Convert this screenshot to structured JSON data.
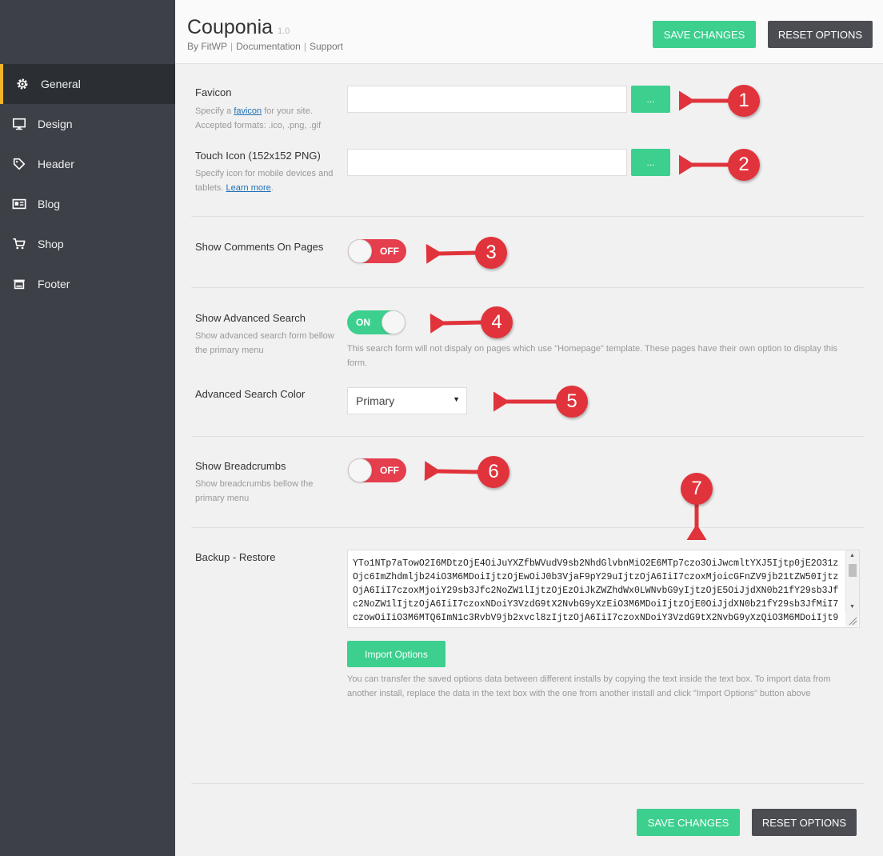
{
  "header": {
    "title": "Couponia",
    "version": "1.0",
    "by": "By FitWP",
    "documentation": "Documentation",
    "support": "Support",
    "save_label": "SAVE CHANGES",
    "reset_label": "RESET OPTIONS"
  },
  "sidebar": {
    "items": [
      {
        "label": "General",
        "icon": "gear-icon",
        "active": true
      },
      {
        "label": "Design",
        "icon": "monitor-icon",
        "active": false
      },
      {
        "label": "Header",
        "icon": "tag-icon",
        "active": false
      },
      {
        "label": "Blog",
        "icon": "newspaper-icon",
        "active": false
      },
      {
        "label": "Shop",
        "icon": "cart-icon",
        "active": false
      },
      {
        "label": "Footer",
        "icon": "footer-icon",
        "active": false
      }
    ]
  },
  "favicon": {
    "label": "Favicon",
    "desc_prefix": "Specify a ",
    "desc_link": "favicon",
    "desc_suffix": " for your site.",
    "desc_formats": "Accepted formats: .ico, .png, .gif",
    "value": "",
    "button": "..."
  },
  "touch_icon": {
    "label": "Touch Icon (152x152 PNG)",
    "desc": "Specify icon for mobile devices and tablets.",
    "desc_link": "Learn more",
    "desc_end": ".",
    "value": "",
    "button": "..."
  },
  "comments": {
    "label": "Show Comments On Pages",
    "state": "OFF"
  },
  "advanced_search": {
    "label": "Show Advanced Search",
    "desc": "Show advanced search form bellow the primary menu",
    "state": "ON",
    "note": "This search form will not dispaly on pages which use \"Homepage\" template. These pages have their own option to display this form."
  },
  "search_color": {
    "label": "Advanced Search Color",
    "selected": "Primary"
  },
  "breadcrumbs": {
    "label": "Show Breadcrumbs",
    "desc": "Show breadcrumbs bellow the primary menu",
    "state": "OFF"
  },
  "backup": {
    "label": "Backup - Restore",
    "text": "YTo1NTp7aTowO2I6MDtzOjE4OiJuYXZfbWVudV9sb2NhdGlvbnMiO2E6MTp7czo3OiJwcmltYXJ5Ijtp0jE2O31zOjc6ImZhdmljb24iO3M6MDoiIjtzOjEwOiJ0b3VjaF9pY29uIjtzOjA6IiI7czoxMjoicGFnZV9jb21tZW50IjtzOjA6IiI7czoxMjoiY29sb3Jfc2NoZW1lIjtzOjEzOiJkZWZhdWx0LWNvbG9yIjtzOjE5OiJjdXN0b21fY29sb3Jfc2NoZW1lIjtzOjA6IiI7czoxNDoiY3VzdG9tX2NvbG9yXzEiO3M6MDoiIjtzOjE0OiJjdXN0b21fY29sb3JfMiI7czowOiIiO3M6MTQ6ImN1c3RvbV9jb2xvcl8zIjtzOjA6IiI7czoxNDoiY3VzdG9tX2NvbG9yXzQiO3M6MDoiIjt9",
    "import_label": "Import Options",
    "note": "You can transfer the saved options data between different installs by copying the text inside the text box. To import data from another install, replace the data in the text box with the one from another install and click \"Import Options\" button above"
  },
  "footer": {
    "save_label": "SAVE CHANGES",
    "reset_label": "RESET OPTIONS"
  },
  "annotations": [
    "1",
    "2",
    "3",
    "4",
    "5",
    "6",
    "7"
  ],
  "colors": {
    "accent_green": "#3ccf8e",
    "toggle_off_red": "#e53e4d",
    "sidebar_bg": "#3d4046",
    "active_marker": "#f0b429",
    "badge_red": "#e1333b"
  }
}
